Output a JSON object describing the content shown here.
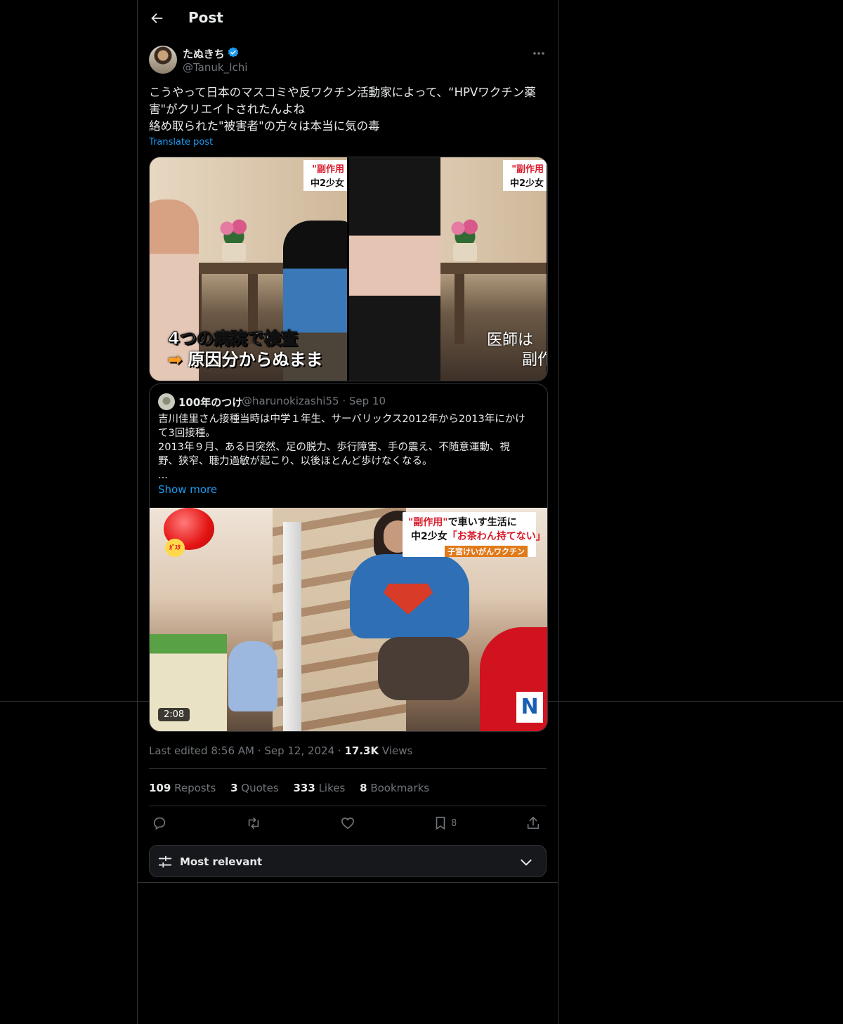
{
  "header": {
    "title": "Post"
  },
  "post": {
    "author_name": "たぬきち",
    "author_handle": "@Tanuk_Ichi",
    "text_lines": [
      "こうやって日本のマスコミや反ワクチン活動家によって、“HPVワクチン薬",
      "害\"がクリエイトされたんよね",
      "絡め取られた\"被害者\"の方々は本当に気の毒"
    ],
    "translate_label": "Translate post"
  },
  "media": {
    "left": {
      "caption_top": "\"副作用",
      "caption_bottom": "中2少女",
      "subtitle_1": "4つの病院で検査",
      "subtitle_2_arrow": "➡",
      "subtitle_2": "原因分からぬまま"
    },
    "right": {
      "caption_top": "\"副作用",
      "caption_bottom": "中2少女",
      "subtitle_1": "医師は",
      "subtitle_2": "副作"
    }
  },
  "quote": {
    "name": "100年のつけ",
    "handle": "@harunokizashi55",
    "date": "Sep 10",
    "text_lines": [
      "吉川佳里さん接種当時は中学１年生、サーバリックス2012年から2013年にかけ",
      "て3回接種。",
      "2013年９月、ある日突然、足の脱力、歩行障害、手の震え、不随意運動、視",
      "野、狭窄、聴力過敏が起こり、以後ほとんど歩けなくなる。",
      "..."
    ],
    "show_more": "Show more",
    "video": {
      "caption_line1_red": "\"副作用\"",
      "caption_line1": "で車いす生活に",
      "caption_line2": "中2少女",
      "caption_line2_red": "「お茶わん持てない」",
      "caption_line3": "子宮けいがんワクチン",
      "tag": "ｶﾞｽﾀ",
      "logo": "N",
      "duration": "2:08"
    }
  },
  "meta": {
    "edited": "Last edited 8:56 AM",
    "date": "Sep 12, 2024",
    "views_count": "17.3K",
    "views_label": "Views"
  },
  "stats": [
    {
      "count": "109",
      "label": "Reposts"
    },
    {
      "count": "3",
      "label": "Quotes"
    },
    {
      "count": "333",
      "label": "Likes"
    },
    {
      "count": "8",
      "label": "Bookmarks"
    }
  ],
  "actions": {
    "reply_icon": "reply-icon",
    "repost_icon": "repost-icon",
    "like_icon": "heart-icon",
    "bookmark_icon": "bookmark-icon",
    "bookmark_count": "8",
    "share_icon": "share-icon"
  },
  "sort": {
    "label": "Most relevant"
  },
  "colors": {
    "accent": "#1d9bf0",
    "muted": "#71767b",
    "border": "#2f3336",
    "text": "#e7e9ea"
  }
}
